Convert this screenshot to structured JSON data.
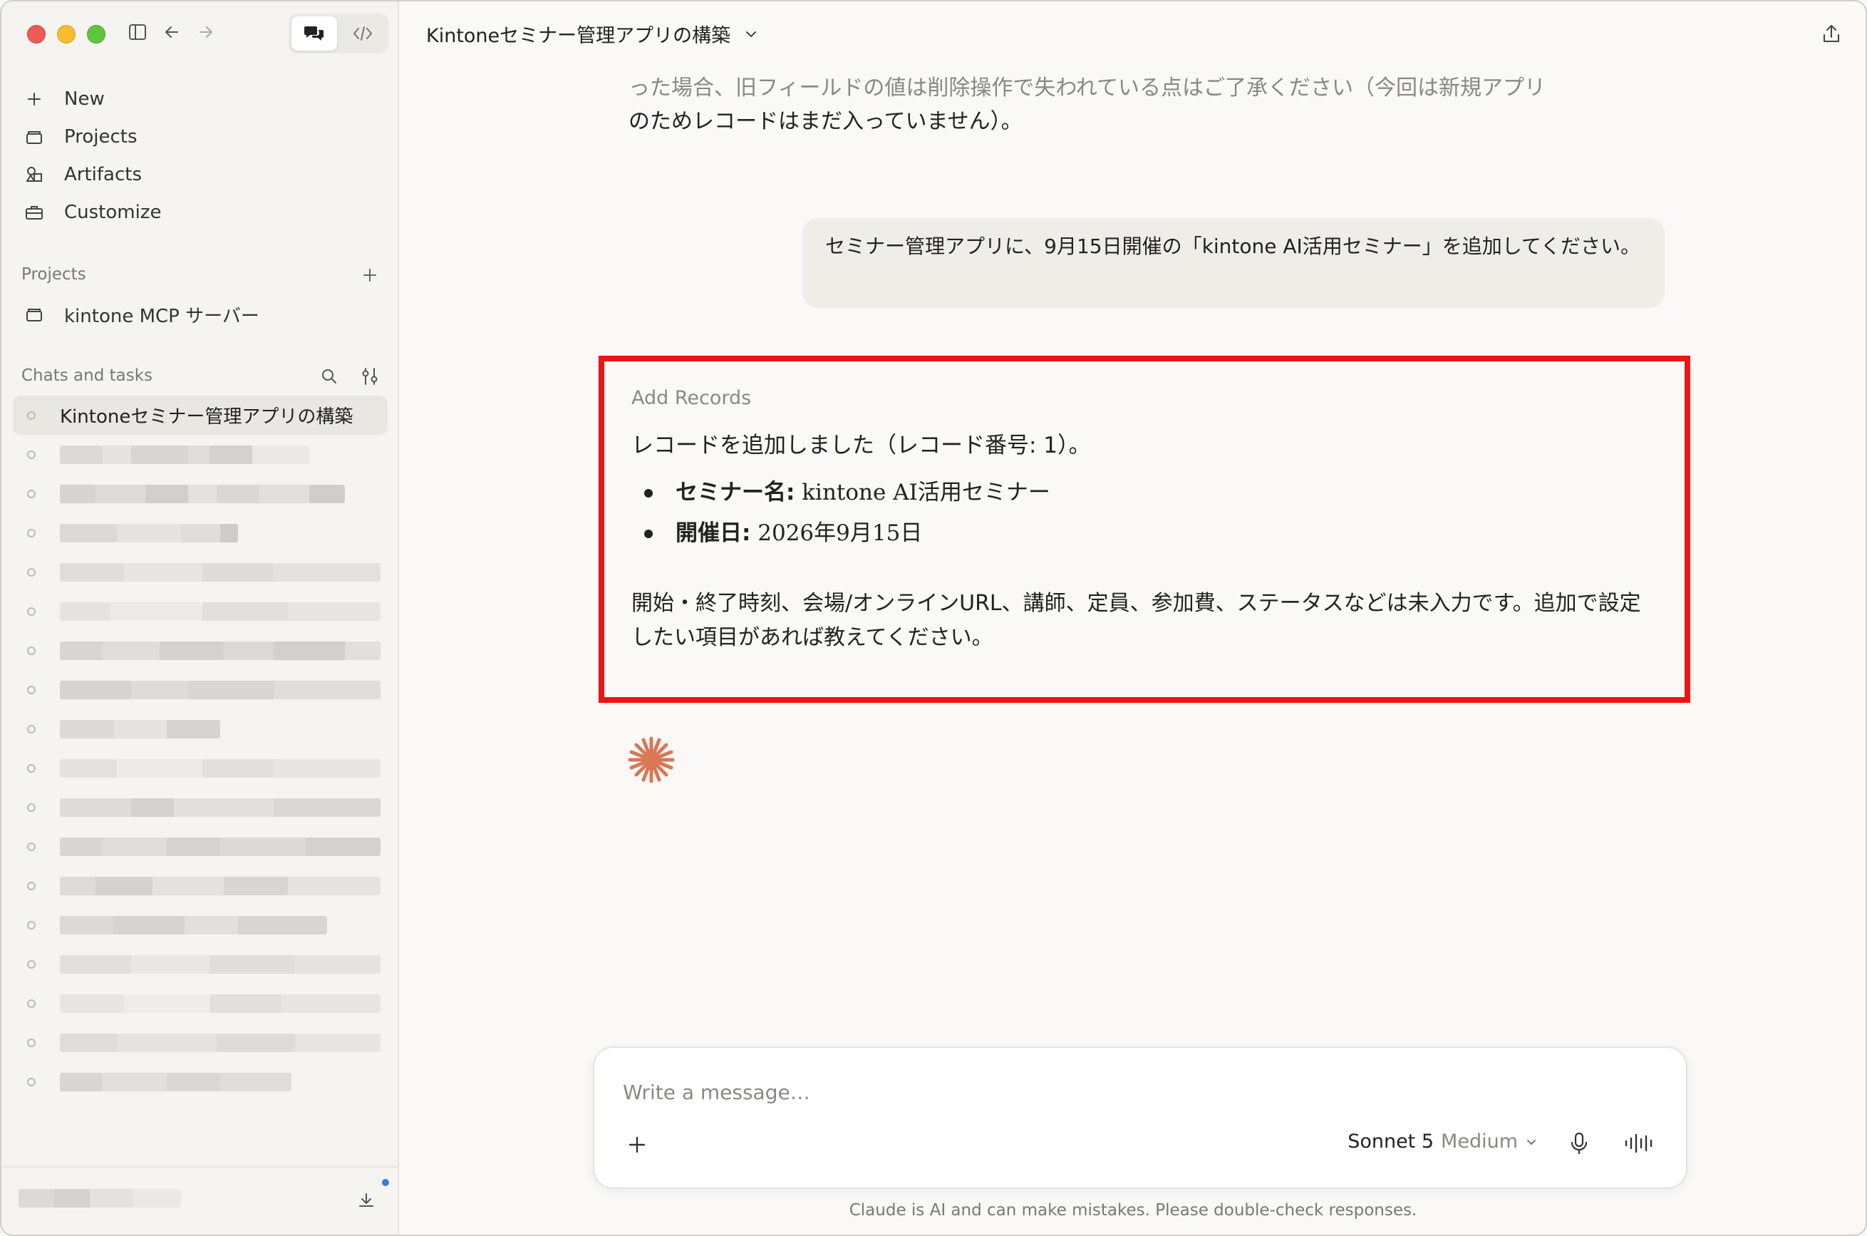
{
  "window": {
    "traffic_lights": [
      "close",
      "minimize",
      "zoom"
    ]
  },
  "sidebar": {
    "nav": [
      {
        "label": "New",
        "icon": "plus-icon"
      },
      {
        "label": "Projects",
        "icon": "folder-icon"
      },
      {
        "label": "Artifacts",
        "icon": "artifacts-icon"
      },
      {
        "label": "Customize",
        "icon": "briefcase-icon"
      }
    ],
    "projects_header": "Projects",
    "projects": [
      {
        "label": "kintone MCP サーバー"
      }
    ],
    "chats_header": "Chats and tasks",
    "chats_active": "Kintoneセミナー管理アプリの構築"
  },
  "header": {
    "title": "Kintoneセミナー管理アプリの構築"
  },
  "conversation": {
    "previous_line1": "った場合、旧フィールドの値は削除操作で失われている点はご了承ください（今回は新規アプリ",
    "previous_line2": "のためレコードはまだ入っていません）。",
    "user_message": "セミナー管理アプリに、9月15日開催の「kintone AI活用セミナー」を追加してください。",
    "tool_label": "Add Records",
    "response_line": "レコードを追加しました（レコード番号: 1）。",
    "bullets": [
      {
        "key": "セミナー名:",
        "value": " kintone AI活用セミナー"
      },
      {
        "key": "開催日:",
        "value": " 2026年9月15日"
      }
    ],
    "response_para": "開始・終了時刻、会場/オンラインURL、講師、定員、参加費、ステータスなどは未入力です。追加で設定したい項目があれば教えてください。"
  },
  "composer": {
    "placeholder": "Write a message…",
    "model_name": "Sonnet 5",
    "model_effort": "Medium"
  },
  "disclaimer": "Claude is AI and can make mistakes. Please double-check responses.",
  "colors": {
    "accent": "#d97757",
    "highlight_border": "#ee1414",
    "notification": "#3a7bd5"
  }
}
